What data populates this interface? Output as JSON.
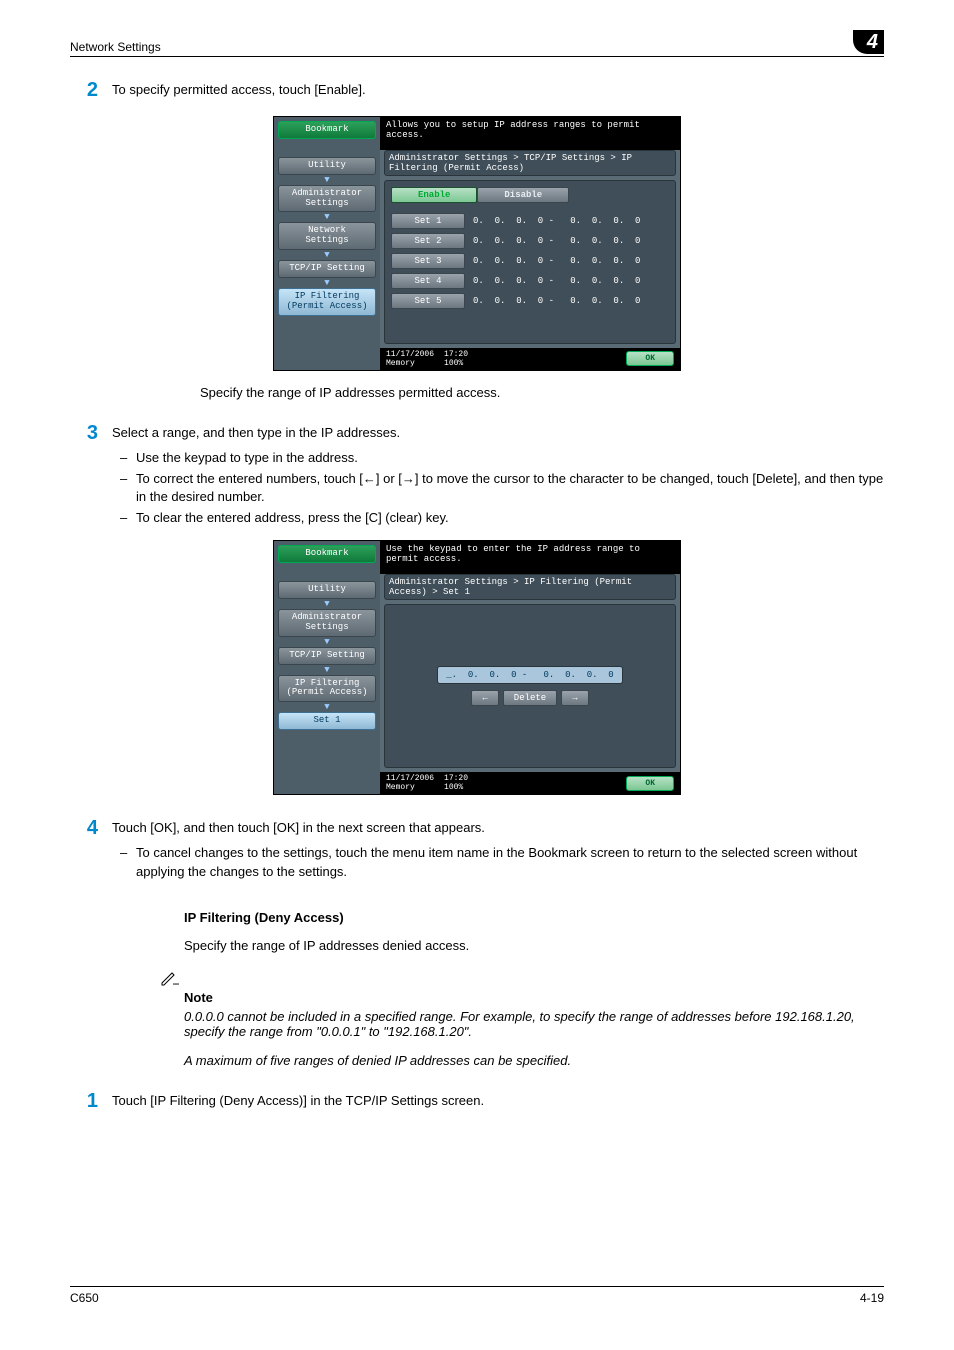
{
  "header": {
    "title": "Network Settings",
    "chapter": "4"
  },
  "steps": {
    "s2": {
      "num": "2",
      "text": "To specify permitted access, touch [Enable].",
      "after": "Specify the range of IP addresses permitted access."
    },
    "s3": {
      "num": "3",
      "text": "Select a range, and then type in the IP addresses.",
      "b1": "Use the keypad to type in the address.",
      "b2": "To correct the entered numbers, touch [←] or [→] to move the cursor to the character to be changed, touch [Delete], and then type in the desired number.",
      "b3": "To clear the entered address, press the [C] (clear) key."
    },
    "s4": {
      "num": "4",
      "text": "Touch [OK], and then touch [OK] in the next screen that appears.",
      "b1": "To cancel changes to the settings, touch the menu item name in the Bookmark screen to return to the selected screen without applying the changes to the settings."
    },
    "s1b": {
      "num": "1",
      "text": "Touch [IP Filtering (Deny Access)] in the TCP/IP Settings screen."
    }
  },
  "section2": {
    "head": "IP Filtering (Deny Access)",
    "body": "Specify the range of IP addresses denied access.",
    "note_head": "Note",
    "note1": "0.0.0.0 cannot be included in a specified range. For example, to specify the range of addresses before 192.168.1.20, specify the range from \"0.0.0.1\" to \"192.168.1.20\".",
    "note2": "A maximum of five ranges of denied IP addresses can be specified."
  },
  "screen1": {
    "topmsg": "Allows you to setup IP address ranges to permit access.",
    "crumb": "Administrator Settings > TCP/IP Settings > IP Filtering (Permit Access)",
    "enable": "Enable",
    "disable": "Disable",
    "side": {
      "bookmark": "Bookmark",
      "utility": "Utility",
      "admin": "Administrator\nSettings",
      "network": "Network\nSettings",
      "tcpip": "TCP/IP Setting",
      "ipfilter": "IP Filtering\n(Permit Access)"
    },
    "rows": [
      {
        "label": "Set 1",
        "vals": "0.  0.  0.  0 -   0.  0.  0.  0"
      },
      {
        "label": "Set 2",
        "vals": "0.  0.  0.  0 -   0.  0.  0.  0"
      },
      {
        "label": "Set 3",
        "vals": "0.  0.  0.  0 -   0.  0.  0.  0"
      },
      {
        "label": "Set 4",
        "vals": "0.  0.  0.  0 -   0.  0.  0.  0"
      },
      {
        "label": "Set 5",
        "vals": "0.  0.  0.  0 -   0.  0.  0.  0"
      }
    ],
    "date": "11/17/2006",
    "time": "17:20",
    "mem": "Memory",
    "memv": "100%",
    "ok": "OK"
  },
  "screen2": {
    "topmsg": "Use the keypad to enter the IP address range to permit access.",
    "crumb": "Administrator Settings > IP Filtering (Permit Access) > Set 1",
    "side": {
      "bookmark": "Bookmark",
      "utility": "Utility",
      "admin": "Administrator\nSettings",
      "tcpip": "TCP/IP Setting",
      "ipfilter": "IP Filtering\n(Permit Access)",
      "set1": "Set 1"
    },
    "ip": "_.  0.  0.  0 -   0.  0.  0.  0",
    "left": "←",
    "delete": "Delete",
    "right": "→",
    "date": "11/17/2006",
    "time": "17:20",
    "mem": "Memory",
    "memv": "100%",
    "ok": "OK"
  },
  "footer": {
    "left": "C650",
    "right": "4-19"
  }
}
